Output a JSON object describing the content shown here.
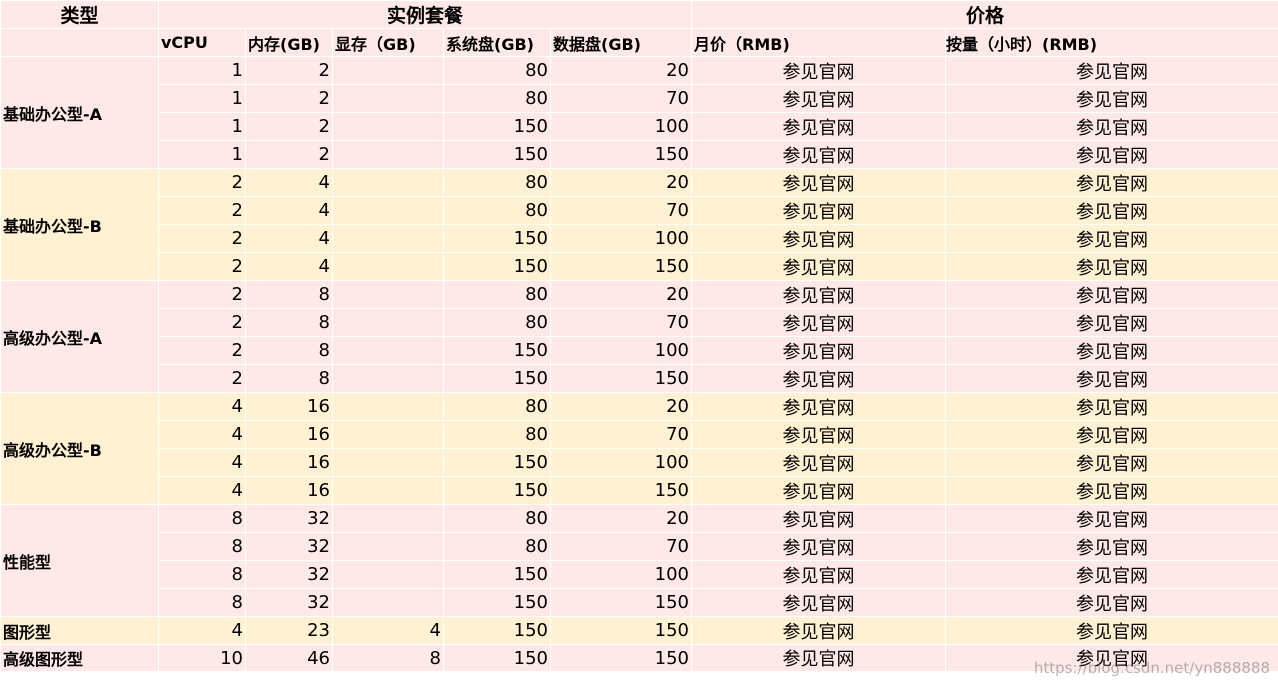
{
  "headers": {
    "type": "类型",
    "instance_package": "实例套餐",
    "price": "价格",
    "vcpu": "vCPU",
    "memory": "内存(GB)",
    "vram": "显存（GB)",
    "system_disk": "系统盘(GB)",
    "data_disk": "数据盘(GB)",
    "monthly_price": "月价（RMB)",
    "hourly_price": "按量（小时）(RMB)"
  },
  "groups": [
    {
      "type": "基础办公型-A",
      "color": "#ffe9e8",
      "rows": [
        {
          "vcpu": "1",
          "memory": "2",
          "vram": "",
          "system_disk": "80",
          "data_disk": "20",
          "monthly": "参见官网",
          "hourly": "参见官网"
        },
        {
          "vcpu": "1",
          "memory": "2",
          "vram": "",
          "system_disk": "80",
          "data_disk": "70",
          "monthly": "参见官网",
          "hourly": "参见官网"
        },
        {
          "vcpu": "1",
          "memory": "2",
          "vram": "",
          "system_disk": "150",
          "data_disk": "100",
          "monthly": "参见官网",
          "hourly": "参见官网"
        },
        {
          "vcpu": "1",
          "memory": "2",
          "vram": "",
          "system_disk": "150",
          "data_disk": "150",
          "monthly": "参见官网",
          "hourly": "参见官网"
        }
      ]
    },
    {
      "type": "基础办公型-B",
      "color": "#fff1d1",
      "rows": [
        {
          "vcpu": "2",
          "memory": "4",
          "vram": "",
          "system_disk": "80",
          "data_disk": "20",
          "monthly": "参见官网",
          "hourly": "参见官网"
        },
        {
          "vcpu": "2",
          "memory": "4",
          "vram": "",
          "system_disk": "80",
          "data_disk": "70",
          "monthly": "参见官网",
          "hourly": "参见官网"
        },
        {
          "vcpu": "2",
          "memory": "4",
          "vram": "",
          "system_disk": "150",
          "data_disk": "100",
          "monthly": "参见官网",
          "hourly": "参见官网"
        },
        {
          "vcpu": "2",
          "memory": "4",
          "vram": "",
          "system_disk": "150",
          "data_disk": "150",
          "monthly": "参见官网",
          "hourly": "参见官网"
        }
      ]
    },
    {
      "type": "高级办公型-A",
      "color": "#ffe9e8",
      "rows": [
        {
          "vcpu": "2",
          "memory": "8",
          "vram": "",
          "system_disk": "80",
          "data_disk": "20",
          "monthly": "参见官网",
          "hourly": "参见官网"
        },
        {
          "vcpu": "2",
          "memory": "8",
          "vram": "",
          "system_disk": "80",
          "data_disk": "70",
          "monthly": "参见官网",
          "hourly": "参见官网"
        },
        {
          "vcpu": "2",
          "memory": "8",
          "vram": "",
          "system_disk": "150",
          "data_disk": "100",
          "monthly": "参见官网",
          "hourly": "参见官网"
        },
        {
          "vcpu": "2",
          "memory": "8",
          "vram": "",
          "system_disk": "150",
          "data_disk": "150",
          "monthly": "参见官网",
          "hourly": "参见官网"
        }
      ]
    },
    {
      "type": "高级办公型-B",
      "color": "#fff1d1",
      "rows": [
        {
          "vcpu": "4",
          "memory": "16",
          "vram": "",
          "system_disk": "80",
          "data_disk": "20",
          "monthly": "参见官网",
          "hourly": "参见官网"
        },
        {
          "vcpu": "4",
          "memory": "16",
          "vram": "",
          "system_disk": "80",
          "data_disk": "70",
          "monthly": "参见官网",
          "hourly": "参见官网"
        },
        {
          "vcpu": "4",
          "memory": "16",
          "vram": "",
          "system_disk": "150",
          "data_disk": "100",
          "monthly": "参见官网",
          "hourly": "参见官网"
        },
        {
          "vcpu": "4",
          "memory": "16",
          "vram": "",
          "system_disk": "150",
          "data_disk": "150",
          "monthly": "参见官网",
          "hourly": "参见官网"
        }
      ]
    },
    {
      "type": "性能型",
      "color": "#ffe9e8",
      "rows": [
        {
          "vcpu": "8",
          "memory": "32",
          "vram": "",
          "system_disk": "80",
          "data_disk": "20",
          "monthly": "参见官网",
          "hourly": "参见官网"
        },
        {
          "vcpu": "8",
          "memory": "32",
          "vram": "",
          "system_disk": "80",
          "data_disk": "70",
          "monthly": "参见官网",
          "hourly": "参见官网"
        },
        {
          "vcpu": "8",
          "memory": "32",
          "vram": "",
          "system_disk": "150",
          "data_disk": "100",
          "monthly": "参见官网",
          "hourly": "参见官网"
        },
        {
          "vcpu": "8",
          "memory": "32",
          "vram": "",
          "system_disk": "150",
          "data_disk": "150",
          "monthly": "参见官网",
          "hourly": "参见官网"
        }
      ]
    },
    {
      "type": "图形型",
      "color": "#fff1d1",
      "rows": [
        {
          "vcpu": "4",
          "memory": "23",
          "vram": "4",
          "system_disk": "150",
          "data_disk": "150",
          "monthly": "参见官网",
          "hourly": "参见官网"
        }
      ]
    },
    {
      "type": "高级图形型",
      "color": "#ffe9e8",
      "rows": [
        {
          "vcpu": "10",
          "memory": "46",
          "vram": "8",
          "system_disk": "150",
          "data_disk": "150",
          "monthly": "参见官网",
          "hourly": "参见官网"
        }
      ]
    }
  ],
  "watermark": "https://blog.csdn.net/yn888888",
  "colors": {
    "pink": "#ffe9e8",
    "yellow": "#fff1d1"
  }
}
